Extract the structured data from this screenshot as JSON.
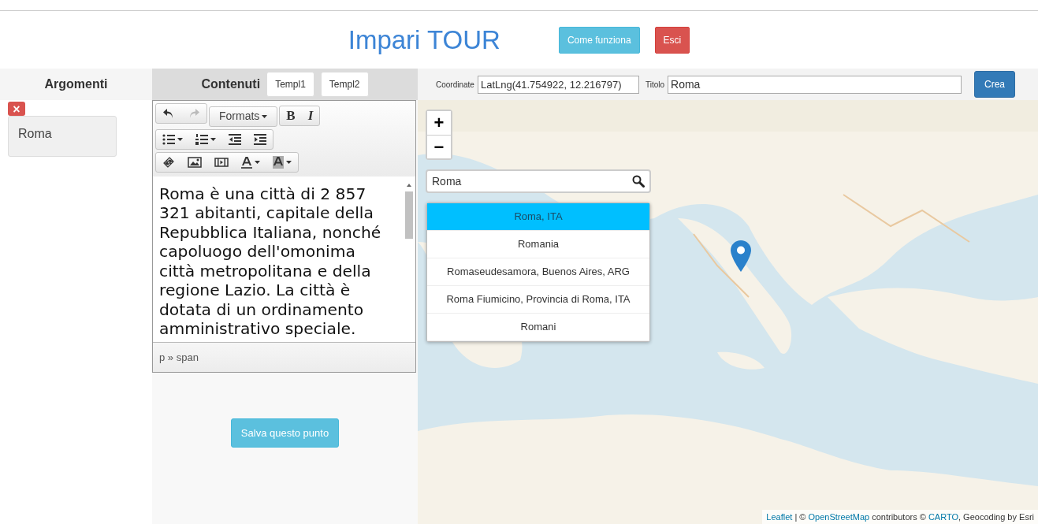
{
  "header": {
    "title": "Impari TOUR",
    "buttons": [
      {
        "label": "Come funziona",
        "kind": "info"
      },
      {
        "label": "Esci",
        "kind": "danger"
      }
    ]
  },
  "argomenti": {
    "heading": "Argomenti",
    "items": [
      {
        "label": "Roma",
        "remove": "×"
      }
    ]
  },
  "contenuti": {
    "heading": "Contenuti",
    "templates": [
      "Templ1",
      "Templ2"
    ],
    "editor": {
      "formats_label": "Formats",
      "bold_label": "B",
      "italic_label": "I",
      "redo_disabled": true,
      "text": "Roma è una città di 2 857 321 abitanti, capitale della Repubblica Italiana, nonché capoluogo dell'omonima città metropolitana e della regione Lazio. La città è dotata di un ordinamento amministrativo speciale.",
      "path": "p » span"
    },
    "save_button": "Salva questo punto"
  },
  "map_form": {
    "coordinate_label": "Coordinate",
    "coordinate_value": "LatLng(41.754922, 12.216797)",
    "title_label": "Titolo",
    "title_value": "Roma",
    "create_button": "Crea"
  },
  "map": {
    "zoom_in": "+",
    "zoom_out": "−",
    "search_value": "Roma",
    "results": [
      {
        "label": "Roma, ITA",
        "selected": true
      },
      {
        "label": "Romania",
        "selected": false
      },
      {
        "label": "Romaseudesamora, Buenos Aires, ARG",
        "selected": false
      },
      {
        "label": "Roma Fiumicino, Provincia di Roma, ITA",
        "selected": false
      },
      {
        "label": "Romani",
        "selected": false
      }
    ],
    "attribution": [
      {
        "text": "Leaflet",
        "link": true
      },
      {
        "text": " | © ",
        "link": false
      },
      {
        "text": "OpenStreetMap",
        "link": true
      },
      {
        "text": " contributors © ",
        "link": false
      },
      {
        "text": "CARTO",
        "link": true
      },
      {
        "text": ", Geocoding by Esri",
        "link": false
      }
    ]
  }
}
